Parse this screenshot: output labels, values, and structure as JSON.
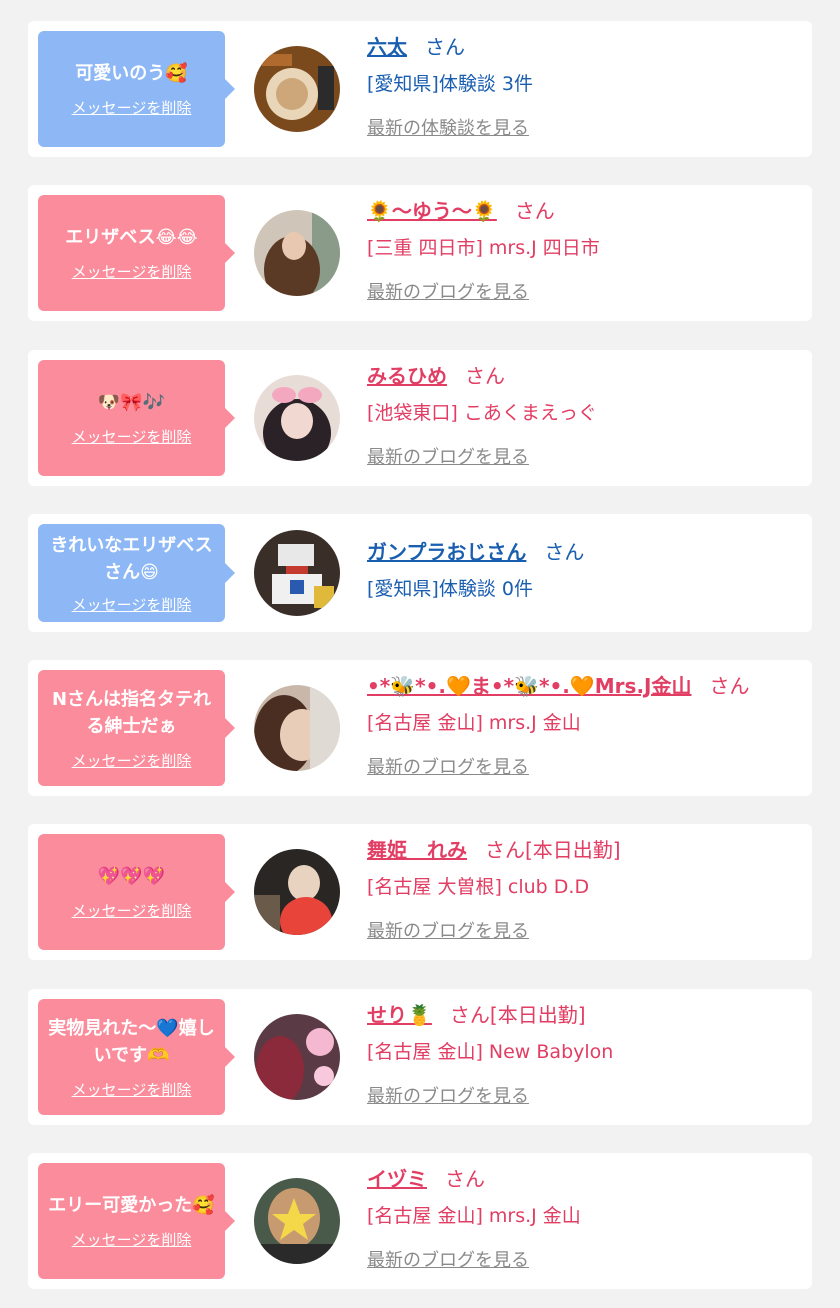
{
  "delete_label": "メッセージを削除",
  "items": [
    {
      "type": "user",
      "bubble_text": "可愛いのう🥰",
      "name": "六太",
      "san": "さん",
      "shop": "[愛知県]体験談 3件",
      "link": "最新の体験談を見る"
    },
    {
      "type": "girl",
      "bubble_text": "エリザベス😂😂",
      "name": "🌻〜ゆう〜🌻",
      "san": "さん",
      "shop": "[三重 四日市] mrs.J 四日市",
      "link": "最新のブログを見る"
    },
    {
      "type": "girl",
      "bubble_text": "🐶🎀🎶",
      "name": "みるひめ",
      "san": "さん",
      "shop": "[池袋東口] こあくまえっぐ",
      "link": "最新のブログを見る"
    },
    {
      "type": "user",
      "bubble_text": "きれいなエリザベスさん😄",
      "name": "ガンプラおじさん",
      "san": "さん",
      "shop": "[愛知県]体験談 0件",
      "link": ""
    },
    {
      "type": "girl",
      "bubble_text": "Nさんは指名タテれる紳士だぁ",
      "name": "•*🐝*•.🧡ま•*🐝*•.🧡Mrs.J金山",
      "san": "さん",
      "shop": "[名古屋 金山] mrs.J 金山",
      "link": "最新のブログを見る"
    },
    {
      "type": "girl",
      "bubble_text": "💖💖💖",
      "name": "舞姫　れみ",
      "san": "さん[本日出勤]",
      "shop": "[名古屋 大曽根] club D.D",
      "link": "最新のブログを見る"
    },
    {
      "type": "girl",
      "bubble_text": "実物見れた〜💙嬉しいです🫶",
      "name": "せり🍍",
      "san": "さん[本日出勤]",
      "shop": "[名古屋 金山] New Babylon",
      "link": "最新のブログを見る"
    },
    {
      "type": "girl",
      "bubble_text": "エリー可愛かった🥰",
      "name": "イヅミ",
      "san": "さん",
      "shop": "[名古屋 金山] mrs.J 金山",
      "link": "最新のブログを見る"
    }
  ],
  "colors": {
    "user_blue": "#1a5eb0",
    "girl_pink": "#e23d63",
    "bubble_blue": "#8db8f5",
    "bubble_pink": "#fb8c9c",
    "page_bg": "#f2f2f2"
  }
}
